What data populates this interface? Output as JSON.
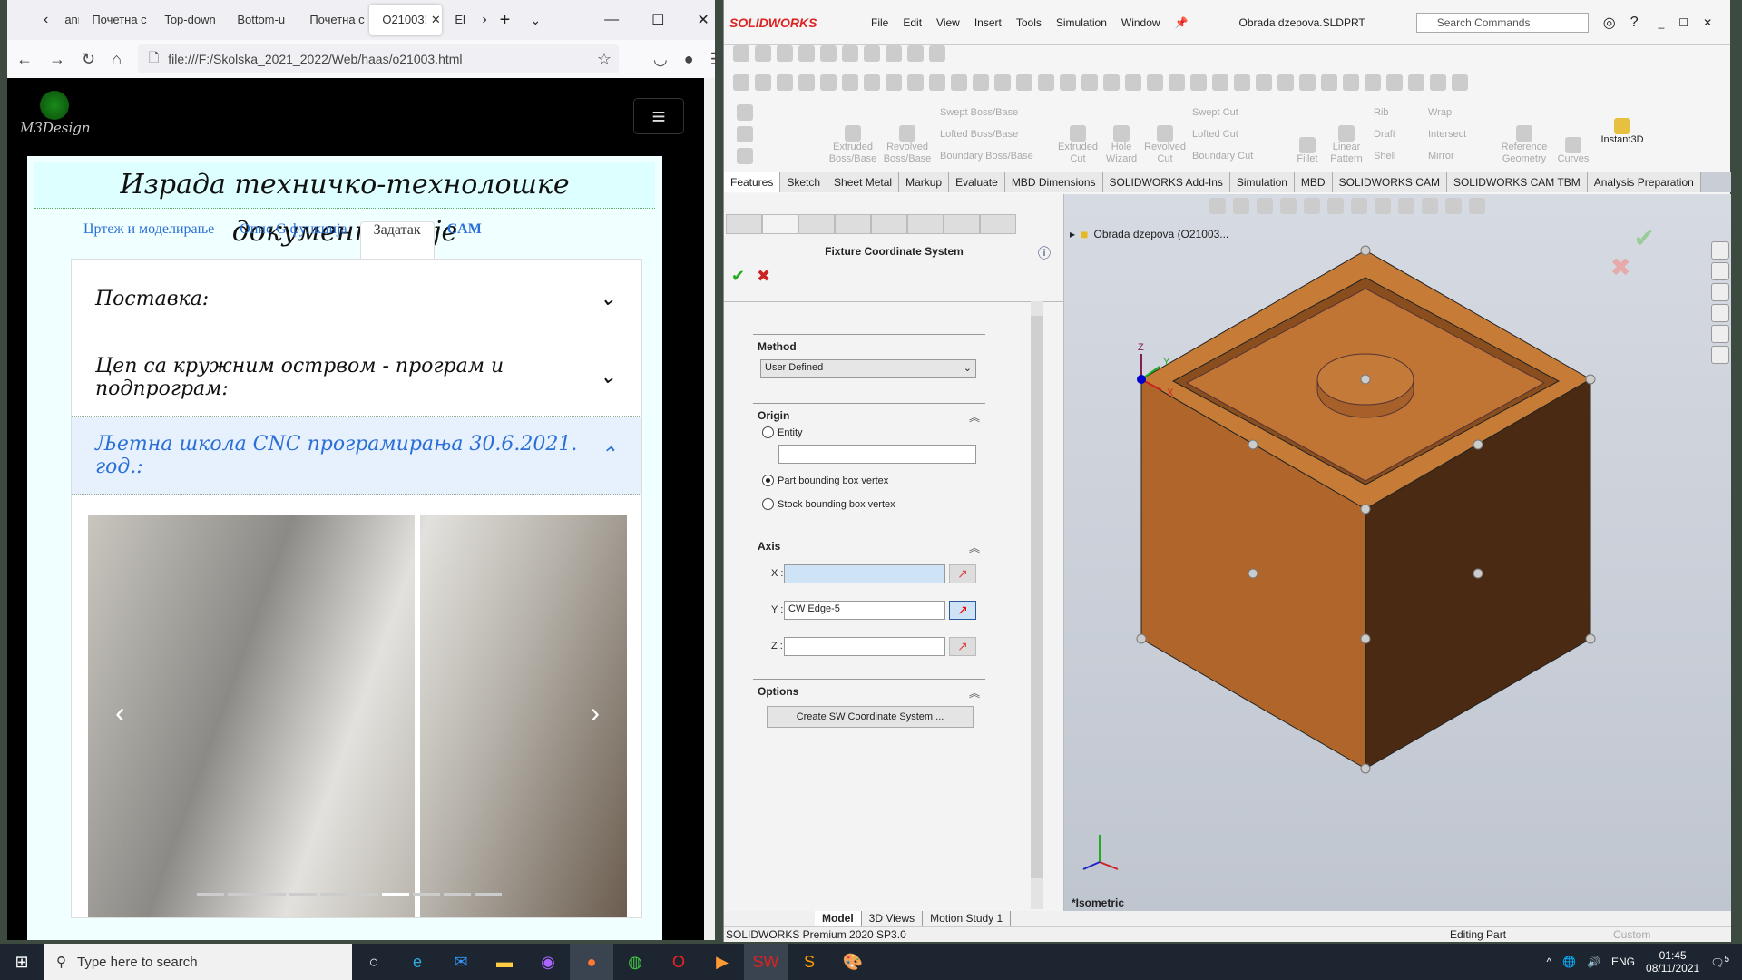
{
  "browser": {
    "tabs": [
      "ann",
      "Почетна с",
      "Top-down",
      "Bottom-u",
      "Почетна с",
      "O21003!",
      "El"
    ],
    "active_tab": 5,
    "url": "file:///F:/Skolska_2021_2022/Web/haas/o21003.html",
    "page": {
      "logo_text": "M3Design",
      "title": "Израда техничко-технолошке документације",
      "tabs": [
        "Цртеж и моделирање",
        "Опис G функција",
        "Задатак",
        "CAM"
      ],
      "active_tab": 2,
      "accordion": [
        {
          "label": "Поставка:",
          "open": false
        },
        {
          "label": "Цеп са кружним острвом - програм и подпрограм:",
          "open": false
        },
        {
          "label": "Љетна школа CNC програмирања 30.6.2021. год.:",
          "open": true
        }
      ],
      "carousel_slides": 10,
      "carousel_active": 6
    }
  },
  "solidworks": {
    "brand": "SOLIDWORKS",
    "menu": [
      "File",
      "Edit",
      "View",
      "Insert",
      "Tools",
      "Simulation",
      "Window"
    ],
    "document_title": "Obrada dzepova.SLDPRT",
    "search_placeholder": "Search Commands",
    "commands": {
      "extruded_boss": "Extruded Boss/Base",
      "revolved_boss": "Revolved Boss/Base",
      "swept_boss": "Swept Boss/Base",
      "lofted_boss": "Lofted Boss/Base",
      "boundary_boss": "Boundary Boss/Base",
      "extruded_cut": "Extruded Cut",
      "hole_wizard": "Hole Wizard",
      "revolved_cut": "Revolved Cut",
      "swept_cut": "Swept Cut",
      "lofted_cut": "Lofted Cut",
      "boundary_cut": "Boundary Cut",
      "fillet": "Fillet",
      "linear_pattern": "Linear Pattern",
      "rib": "Rib",
      "draft": "Draft",
      "shell": "Shell",
      "wrap": "Wrap",
      "intersect": "Intersect",
      "mirror": "Mirror",
      "reference_geometry": "Reference Geometry",
      "curves": "Curves",
      "instant3d": "Instant3D"
    },
    "cm_tabs": [
      "Features",
      "Sketch",
      "Sheet Metal",
      "Markup",
      "Evaluate",
      "MBD Dimensions",
      "SOLIDWORKS Add-Ins",
      "Simulation",
      "MBD",
      "SOLIDWORKS CAM",
      "SOLIDWORKS CAM TBM",
      "Analysis Preparation"
    ],
    "active_cm_tab": 0,
    "property_manager": {
      "title": "Fixture Coordinate System",
      "method_label": "Method",
      "method_value": "User Defined",
      "origin_label": "Origin",
      "origin_options": [
        "Entity",
        "Part bounding box vertex",
        "Stock bounding box vertex"
      ],
      "origin_selected": 1,
      "entity_value": "",
      "axis_label": "Axis",
      "axes": [
        {
          "label": "X :",
          "value": ""
        },
        {
          "label": "Y :",
          "value": "CW Edge-5"
        },
        {
          "label": "Z :",
          "value": ""
        }
      ],
      "options_label": "Options",
      "create_button": "Create SW Coordinate System ..."
    },
    "tree_item": "Obrada dzepova  (O21003...",
    "view_name": "*Isometric",
    "triad": {
      "x": "X",
      "y": "Y",
      "z": "Z"
    },
    "model_tabs": [
      "Model",
      "3D Views",
      "Motion Study 1"
    ],
    "active_model_tab": 0,
    "status_left": "SOLIDWORKS Premium 2020 SP3.0",
    "status_mode": "Editing Part",
    "status_units": "Custom",
    "colors": {
      "part": "#c0742f",
      "part_dark": "#4a2a10",
      "viewport": "#cdd2da",
      "accent_red": "#d22222"
    }
  },
  "taskbar": {
    "search_placeholder": "Type here to search",
    "language": "ENG",
    "time": "01:45",
    "date": "08/11/2021",
    "notifications": "5"
  }
}
